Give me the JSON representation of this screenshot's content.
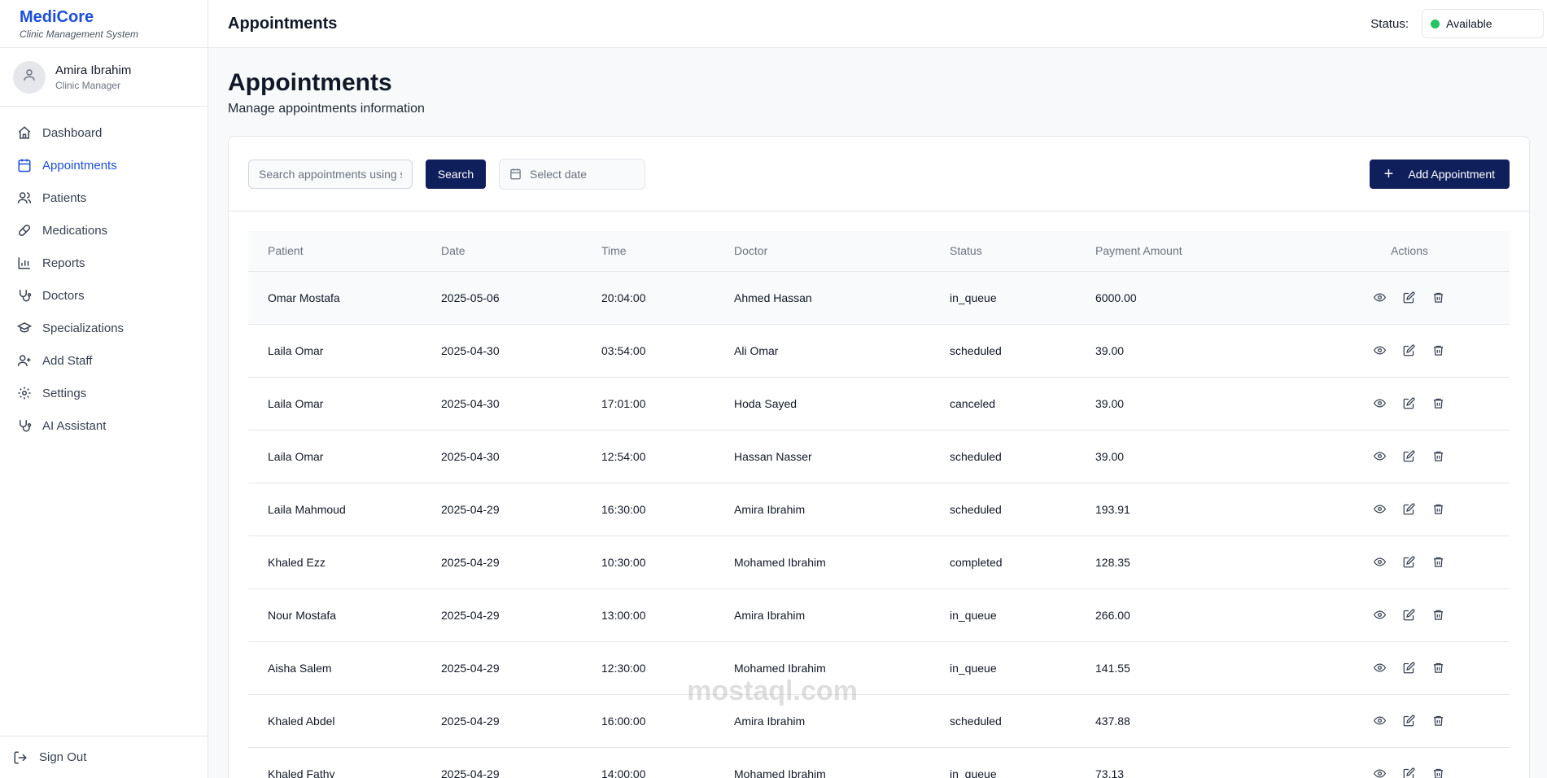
{
  "brand": {
    "name": "MediCore",
    "subtitle": "Clinic Management System"
  },
  "user": {
    "name": "Amira Ibrahim",
    "role": "Clinic Manager"
  },
  "nav": [
    {
      "label": "Dashboard",
      "icon": "home-icon",
      "active": false
    },
    {
      "label": "Appointments",
      "icon": "calendar-icon",
      "active": true
    },
    {
      "label": "Patients",
      "icon": "users-icon",
      "active": false
    },
    {
      "label": "Medications",
      "icon": "pill-icon",
      "active": false
    },
    {
      "label": "Reports",
      "icon": "bar-chart-icon",
      "active": false
    },
    {
      "label": "Doctors",
      "icon": "stethoscope-icon",
      "active": false
    },
    {
      "label": "Specializations",
      "icon": "graduation-cap-icon",
      "active": false
    },
    {
      "label": "Add Staff",
      "icon": "user-plus-icon",
      "active": false
    },
    {
      "label": "Settings",
      "icon": "gear-icon",
      "active": false
    },
    {
      "label": "AI Assistant",
      "icon": "stethoscope-icon",
      "active": false
    }
  ],
  "signout": {
    "label": "Sign Out"
  },
  "header": {
    "title": "Appointments",
    "status_label": "Status:",
    "status_value": "Available",
    "status_color": "#22c55e"
  },
  "page": {
    "title": "Appointments",
    "subtitle": "Manage appointments information"
  },
  "toolbar": {
    "search_placeholder": "Search appointments using s",
    "search_button": "Search",
    "date_placeholder": "Select date",
    "add_button": "Add Appointment"
  },
  "table": {
    "headers": {
      "patient": "Patient",
      "date": "Date",
      "time": "Time",
      "doctor": "Doctor",
      "status": "Status",
      "payment": "Payment Amount",
      "actions": "Actions"
    },
    "rows": [
      {
        "patient": "Omar Mostafa",
        "date": "2025-05-06",
        "time": "20:04:00",
        "doctor": "Ahmed Hassan",
        "status": "in_queue",
        "payment": "6000.00"
      },
      {
        "patient": "Laila Omar",
        "date": "2025-04-30",
        "time": "03:54:00",
        "doctor": "Ali Omar",
        "status": "scheduled",
        "payment": "39.00"
      },
      {
        "patient": "Laila Omar",
        "date": "2025-04-30",
        "time": "17:01:00",
        "doctor": "Hoda Sayed",
        "status": "canceled",
        "payment": "39.00"
      },
      {
        "patient": "Laila Omar",
        "date": "2025-04-30",
        "time": "12:54:00",
        "doctor": "Hassan Nasser",
        "status": "scheduled",
        "payment": "39.00"
      },
      {
        "patient": "Laila Mahmoud",
        "date": "2025-04-29",
        "time": "16:30:00",
        "doctor": "Amira Ibrahim",
        "status": "scheduled",
        "payment": "193.91"
      },
      {
        "patient": "Khaled Ezz",
        "date": "2025-04-29",
        "time": "10:30:00",
        "doctor": "Mohamed Ibrahim",
        "status": "completed",
        "payment": "128.35"
      },
      {
        "patient": "Nour Mostafa",
        "date": "2025-04-29",
        "time": "13:00:00",
        "doctor": "Amira Ibrahim",
        "status": "in_queue",
        "payment": "266.00"
      },
      {
        "patient": "Aisha Salem",
        "date": "2025-04-29",
        "time": "12:30:00",
        "doctor": "Mohamed Ibrahim",
        "status": "in_queue",
        "payment": "141.55"
      },
      {
        "patient": "Khaled Abdel",
        "date": "2025-04-29",
        "time": "16:00:00",
        "doctor": "Amira Ibrahim",
        "status": "scheduled",
        "payment": "437.88"
      },
      {
        "patient": "Khaled Fathy",
        "date": "2025-04-29",
        "time": "14:00:00",
        "doctor": "Mohamed Ibrahim",
        "status": "in_queue",
        "payment": "73.13"
      }
    ]
  },
  "watermark": "mostaql.com"
}
